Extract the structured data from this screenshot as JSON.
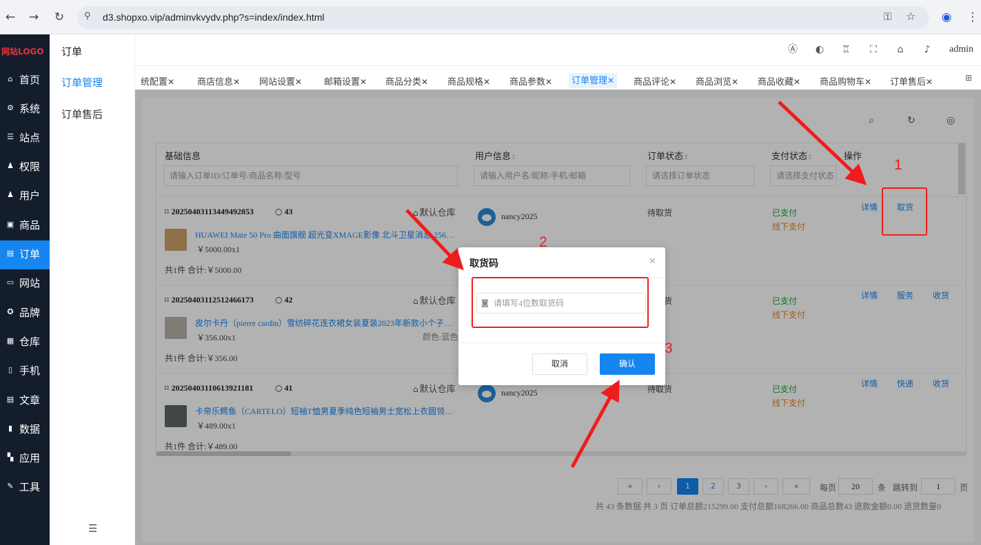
{
  "browser": {
    "url": "d3.shopxo.vip/adminvkvydv.php?s=index/index.html",
    "back_glyph": "←",
    "forward_glyph": "→",
    "reload_glyph": "↻",
    "site_glyph": "⚲",
    "key_glyph": "⚿",
    "star_glyph": "☆",
    "profile_glyph": "◉",
    "menu_glyph": "⋮"
  },
  "sidebar": {
    "logo": "网站LOGO",
    "items": [
      {
        "label": "首页",
        "icon": "home-icon",
        "glyph": "⌂"
      },
      {
        "label": "系统",
        "icon": "gear-icon",
        "glyph": "⚙"
      },
      {
        "label": "站点",
        "icon": "sliders-icon",
        "glyph": "☰"
      },
      {
        "label": "权限",
        "icon": "user-lock-icon",
        "glyph": "♟"
      },
      {
        "label": "用户",
        "icon": "user-icon",
        "glyph": "♟"
      },
      {
        "label": "商品",
        "icon": "box-icon",
        "glyph": "▣"
      },
      {
        "label": "订单",
        "icon": "order-icon",
        "glyph": "▤"
      },
      {
        "label": "网站",
        "icon": "monitor-icon",
        "glyph": "▭"
      },
      {
        "label": "品牌",
        "icon": "badge-icon",
        "glyph": "✪"
      },
      {
        "label": "仓库",
        "icon": "warehouse-icon",
        "glyph": "▦"
      },
      {
        "label": "手机",
        "icon": "mobile-icon",
        "glyph": "▯"
      },
      {
        "label": "文章",
        "icon": "article-icon",
        "glyph": "▤"
      },
      {
        "label": "数据",
        "icon": "bar-chart-icon",
        "glyph": "▮"
      },
      {
        "label": "应用",
        "icon": "apps-icon",
        "glyph": "▚"
      },
      {
        "label": "工具",
        "icon": "wrench-icon",
        "glyph": "✎"
      }
    ]
  },
  "subnav": {
    "title": "订单",
    "items": [
      "订单管理",
      "订单售后"
    ],
    "collapse_glyph": "☰"
  },
  "header": {
    "user": "admin",
    "icons": [
      {
        "name": "translate-icon",
        "glyph": "Ⓐ"
      },
      {
        "name": "palette-icon",
        "glyph": "◐"
      },
      {
        "name": "cake-icon",
        "glyph": "♖"
      },
      {
        "name": "fullscreen-icon",
        "glyph": "⛶"
      },
      {
        "name": "home-icon",
        "glyph": "⌂"
      },
      {
        "name": "bell-icon",
        "glyph": "♪"
      }
    ]
  },
  "tabs": {
    "items": [
      "统配置",
      "商店信息",
      "网站设置",
      "邮箱设置",
      "商品分类",
      "商品规格",
      "商品参数",
      "订单管理",
      "商品评论",
      "商品浏览",
      "商品收藏",
      "商品购物车",
      "订单售后"
    ],
    "close_glyph": "✕",
    "more_glyph": "⊞"
  },
  "toolbar": {
    "search_glyph": "⌕",
    "refresh_glyph": "↻",
    "settings_glyph": "◎"
  },
  "table": {
    "headers": {
      "basic": "基础信息",
      "user": "用户信息",
      "order_status": "订单状态",
      "pay_status": "支付状态",
      "actions": "操作"
    },
    "sort_glyph": "⇕",
    "filters": {
      "basic_placeholder": "请输入订单ID/订单号/商品名称/型号",
      "user_placeholder": "请输入用户名/昵称/手机/邮箱",
      "order_status_placeholder": "请选择订单状态",
      "pay_status_placeholder": "请选择支付状态"
    },
    "icons": {
      "bookmark_glyph": "⌑",
      "circle_glyph": "○",
      "home_glyph": "⌂"
    },
    "rows": [
      {
        "order_no": "20250403113449492853",
        "count": "43",
        "warehouse": "默认仓库",
        "product": "HUAWEI Mate 50 Pro 曲面旗舰 超光变XMAGE影像 北斗卫星消息 256…",
        "price": "￥5000.00x1",
        "spec": "",
        "total": "共1件 合计:￥5000.00",
        "user": "nancy2025",
        "order_status": "待取货",
        "pay_status": "已支付",
        "pay_method": "线下支付",
        "actions": [
          "详情",
          "取货"
        ],
        "thumb_color": "#c9a36b"
      },
      {
        "order_no": "20250403112512466173",
        "count": "42",
        "warehouse": "默认仓库",
        "product": "皮尔卡丹（pierre cardin）雪纺碎花连衣裙女装夏装2023年新款小个子…",
        "price": "￥356.00x1",
        "spec": "颜色:蓝色",
        "total": "共1件 合计:￥356.00",
        "user": "",
        "order_status": "待发货",
        "pay_status": "已支付",
        "pay_method": "线下支付",
        "actions": [
          "详情",
          "服务",
          "收货"
        ],
        "thumb_color": "#b8b2a8"
      },
      {
        "order_no": "20250403110613921181",
        "count": "41",
        "warehouse": "默认仓库",
        "product": "卡帝乐鳄鱼（CARTELO）短袖T恤男夏季纯色短袖男士宽松上衣圆领…",
        "price": "￥489.00x1",
        "spec": "",
        "total": "共1件 合计:￥489.00",
        "user": "nancy2025",
        "order_status": "待取货",
        "pay_status": "已支付",
        "pay_method": "线下支付",
        "actions": [
          "详情",
          "快递",
          "收货"
        ],
        "thumb_color": "#5d6660"
      }
    ]
  },
  "pagination": {
    "first": "«",
    "prev": "‹",
    "pages": [
      "1",
      "2",
      "3"
    ],
    "next": "›",
    "last": "»",
    "per_page_label": "每页",
    "per_page_value": "20",
    "per_page_unit": "条",
    "jump_label": "跳转到",
    "jump_value": "1",
    "page_unit": "页",
    "summary": "共 43 条数据   共 3 页   订单总额215299.00   支付总额168266.00   商品总数43   退款金额0.00   退货数量0"
  },
  "modal": {
    "title": "取货码",
    "close_glyph": "✕",
    "input_placeholder": "请填写4位数取货码",
    "camera_glyph": "◙",
    "cancel_label": "取消",
    "confirm_label": "确认"
  },
  "annotations": {
    "labels": [
      "1",
      "2",
      "3"
    ],
    "color": "#f01c1c"
  }
}
